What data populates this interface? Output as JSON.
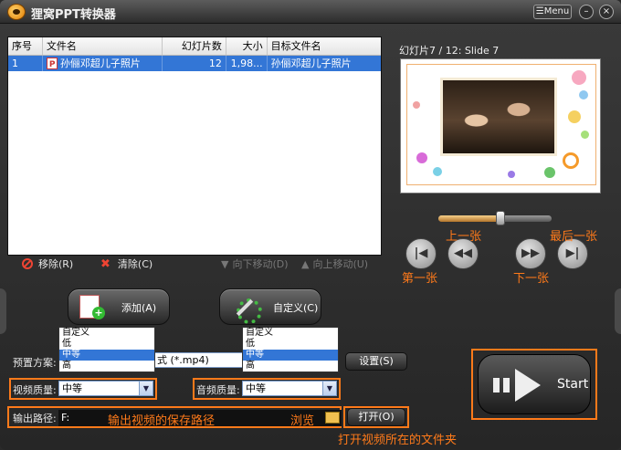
{
  "window": {
    "title": "狸窝PPT转换器",
    "menu_label": "Menu",
    "minimize": "–",
    "close": "×"
  },
  "file_list": {
    "columns": [
      "序号",
      "文件名",
      "幻灯片数",
      "大小",
      "目标文件名"
    ],
    "rows": [
      {
        "index": "1",
        "file": "孙俪邓超儿子照片",
        "slides": "12",
        "size": "1,98...",
        "target": "孙俪邓超儿子照片"
      }
    ]
  },
  "list_tools": {
    "remove": "移除(R)",
    "clear": "清除(C)",
    "move_down": "向下移动(D)",
    "move_up": "向上移动(U)"
  },
  "preview": {
    "title": "幻灯片7 / 12: Slide 7",
    "seek_fraction": 0.55
  },
  "player_buttons": {
    "first": "|◀",
    "prev": "◀◀",
    "next": "▶▶",
    "last": "▶|"
  },
  "annotations": {
    "prev": "上一张",
    "last": "最后一张",
    "first": "第一张",
    "next": "下一张",
    "output_path": "输出视频的保存路径",
    "browse": "浏览",
    "open_folder": "打开视频所在的文件夹"
  },
  "actions": {
    "add": "添加(A)",
    "custom": "自定义(C)"
  },
  "form": {
    "preset_label": "预置方案:",
    "preset_value": "式 (*.mp4)",
    "settings_button": "设置(S)",
    "video_quality_label": "视频质量:",
    "video_quality_value": "中等",
    "audio_quality_label": "音频质量:",
    "audio_quality_value": "中等",
    "output_label": "输出路径:",
    "output_value": "F:",
    "open_button": "打开(O)"
  },
  "quality_options": [
    "自定义",
    "低",
    "中等",
    "高"
  ],
  "start_label": "Start",
  "colors": {
    "accent": "#ff7a1a",
    "selection": "#3376d6"
  }
}
